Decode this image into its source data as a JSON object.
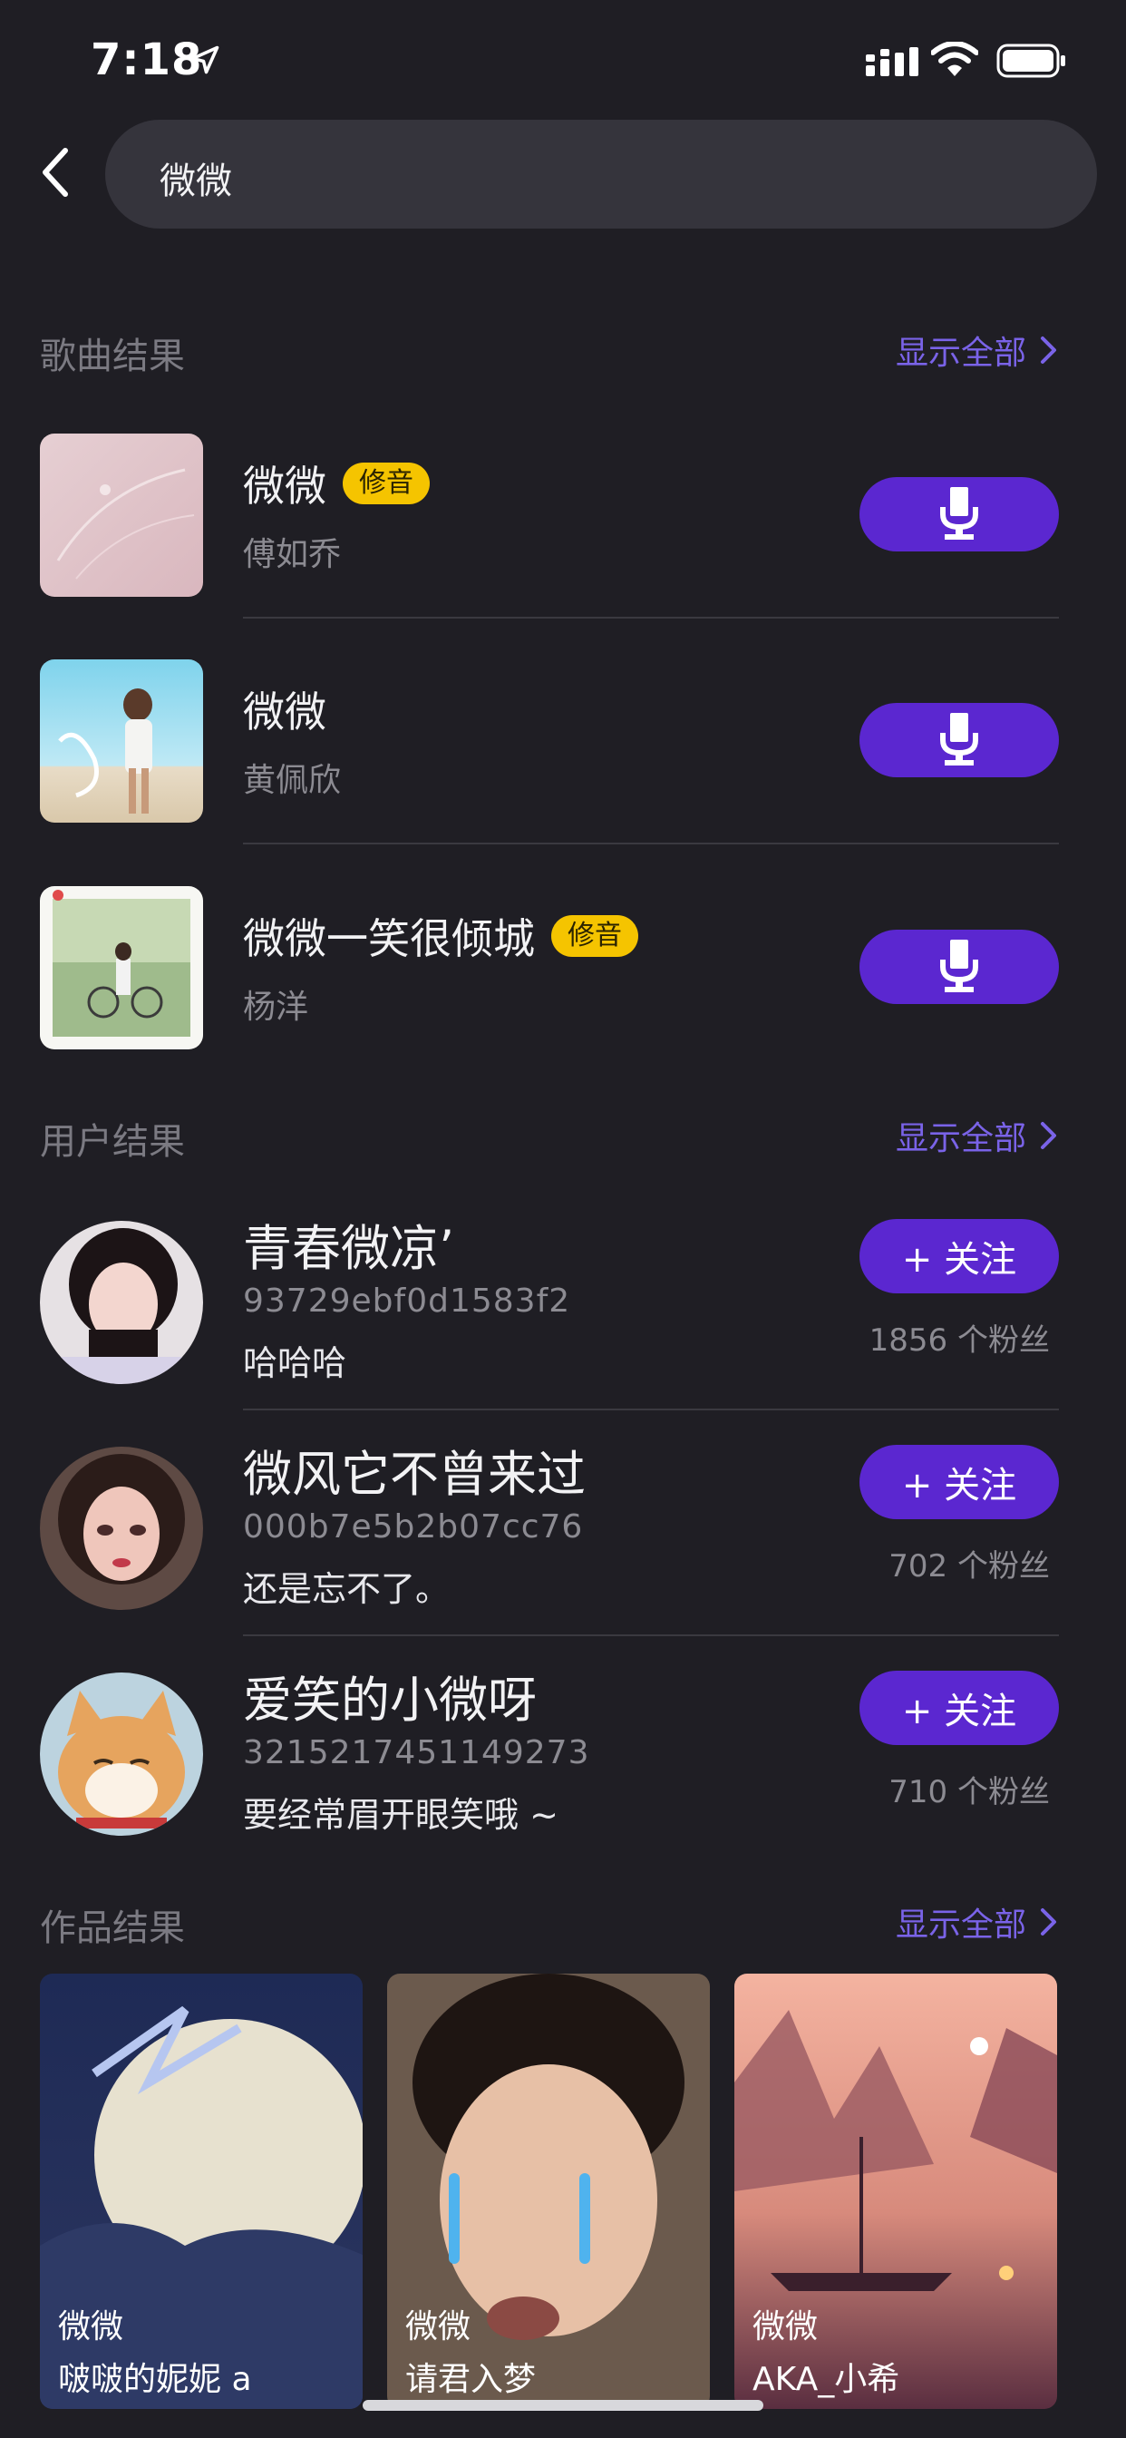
{
  "status_bar": {
    "time": "7:18"
  },
  "search": {
    "query": "微微"
  },
  "songs_section": {
    "title": "歌曲结果",
    "show_all": "显示全部",
    "items": [
      {
        "title": "微微",
        "tag": "修音",
        "artist": "傅如乔"
      },
      {
        "title": "微微",
        "tag": "",
        "artist": "黄佩欣"
      },
      {
        "title": "微微一笑很倾城",
        "tag": "修音",
        "artist": "杨洋"
      }
    ]
  },
  "users_section": {
    "title": "用户结果",
    "show_all": "显示全部",
    "items": [
      {
        "name": "青春微凉’",
        "id": "93729ebf0d1583f2",
        "bio": "哈哈哈",
        "follow": "+ 关注",
        "fans": "1856 个粉丝"
      },
      {
        "name": "微风它不曾来过",
        "id": "000b7e5b2b07cc76",
        "bio": "还是忘不了。",
        "follow": "+ 关注",
        "fans": "702 个粉丝"
      },
      {
        "name": "爱笑的小微呀",
        "id": "3215217451149273",
        "bio": "要经常眉开眼笑哦 ~",
        "follow": "+ 关注",
        "fans": "710 个粉丝"
      }
    ]
  },
  "works_section": {
    "title": "作品结果",
    "show_all": "显示全部",
    "items": [
      {
        "title": "微微",
        "author": "啵啵的妮妮 a"
      },
      {
        "title": "微微",
        "author": "请君入梦"
      },
      {
        "title": "微微",
        "author": "AKA_小希"
      }
    ]
  },
  "colors": {
    "accent": "#5b27d0",
    "link": "#7a63e8",
    "tag": "#f5c400",
    "background": "#1f1e24"
  }
}
